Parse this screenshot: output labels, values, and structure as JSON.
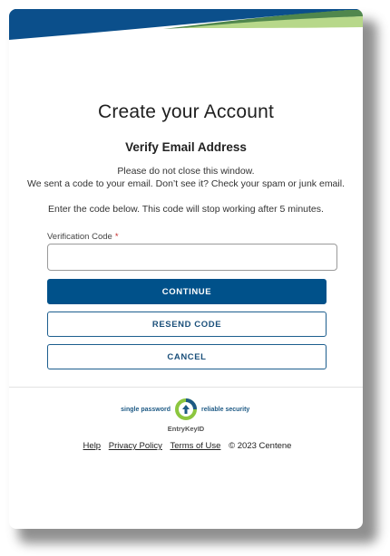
{
  "page": {
    "title": "Create your Account",
    "subtitle": "Verify Email Address"
  },
  "info": {
    "line1": "Please do not close this window.",
    "line2": "We sent a code to your email. Don’t see it? Check your spam or junk email.",
    "line3": "Enter the code below. This code will stop working after 5 minutes."
  },
  "form": {
    "code_label": "Verification Code",
    "required_marker": "*",
    "code_value": "",
    "code_placeholder": ""
  },
  "buttons": {
    "continue": "CONTINUE",
    "resend": "RESEND CODE",
    "cancel": "CANCEL"
  },
  "logo": {
    "tagline_left": "single password",
    "tagline_right": "reliable security",
    "name": "EntryKeyID",
    "icon": "entrykey-logo-icon"
  },
  "footer": {
    "help": "Help",
    "privacy": "Privacy Policy",
    "terms": "Terms of Use",
    "copyright": "© 2023 Centene"
  },
  "colors": {
    "primary": "#00518a",
    "header_blue": "#0a4f8a",
    "header_green": "#8cc63f",
    "required": "#c62828"
  }
}
